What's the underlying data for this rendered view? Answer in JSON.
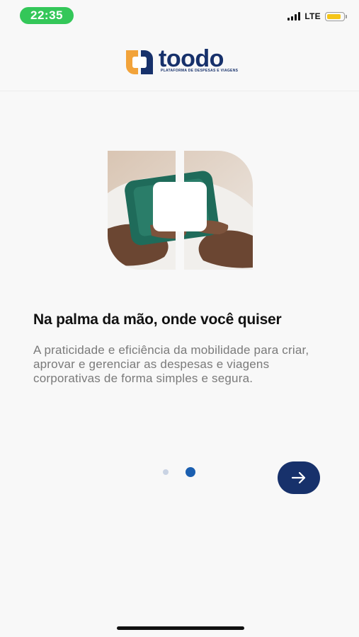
{
  "status_bar": {
    "time": "22:35",
    "network": "LTE",
    "battery_color": "#f5c518",
    "time_pill_color": "#34c759"
  },
  "header": {
    "logo_word": "toodo",
    "logo_tagline": "PLATAFORMA DE DESPESAS E VIAGENS",
    "brand_blue": "#17316b",
    "brand_orange": "#f2a33a"
  },
  "onboarding": {
    "title": "Na palma da mão, onde você quiser",
    "description": "A praticidade e eficiência da mobilidade para criar, aprovar e gerenciar as despesas e viagens corporativas de forma simples e segura.",
    "page_count": 2,
    "current_page": 2,
    "next_icon": "arrow-right-icon",
    "active_dot_color": "#1b5fb0"
  }
}
